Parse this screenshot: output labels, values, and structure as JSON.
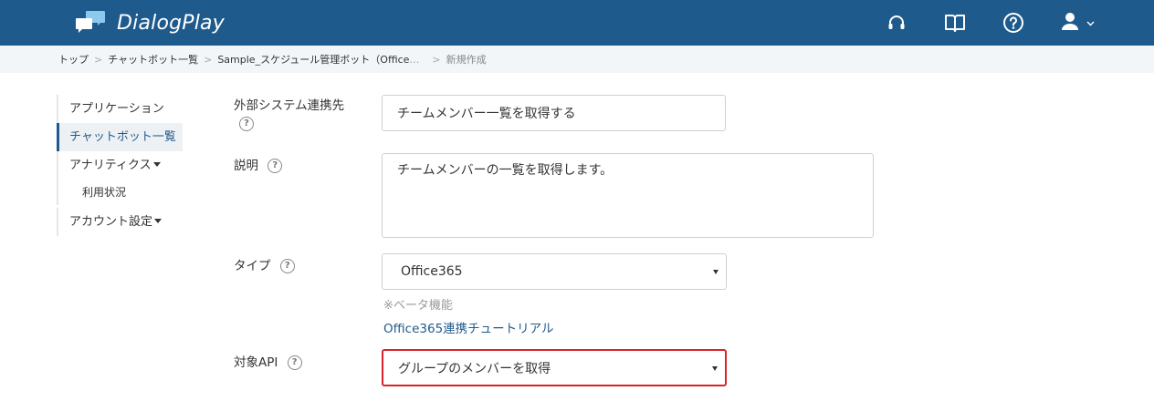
{
  "app": {
    "name": "DialogPlay",
    "brand_color": "#1f5a8c",
    "header_icons": [
      "headset-icon",
      "book-icon",
      "help-circle-icon",
      "user-icon",
      "chevron-down-icon"
    ]
  },
  "breadcrumb": {
    "items": [
      "トップ",
      "チャットボット一覧",
      "Sample_スケジュール管理ボット（Office"
    ],
    "ellipsis": "…",
    "current": "新規作成",
    "separator": ">"
  },
  "sidebar": {
    "items": [
      {
        "label": "アプリケーション"
      },
      {
        "label": "チャットボット一覧",
        "active": true
      },
      {
        "label": "アナリティクス"
      },
      {
        "label": "利用状況"
      },
      {
        "label": "アカウント設定"
      }
    ]
  },
  "form": {
    "help_glyph": "?",
    "external_system": {
      "label": "外部システム連携先",
      "value": "チームメンバー一覧を取得する"
    },
    "description": {
      "label": "説明",
      "value": "チームメンバーの一覧を取得します。"
    },
    "type": {
      "label": "タイプ",
      "selected": "Office365",
      "note": "※ベータ機能",
      "tutorial_link": "Office365連携チュートリアル"
    },
    "target_api": {
      "label": "対象API",
      "selected": "グループのメンバーを取得",
      "highlight_color": "#d9232a"
    }
  }
}
